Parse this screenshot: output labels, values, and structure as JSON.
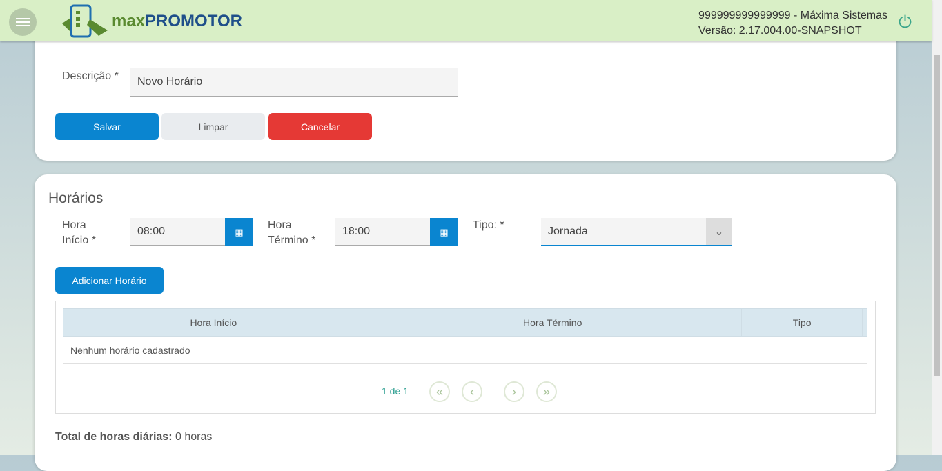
{
  "header": {
    "logo_prefix": "max",
    "logo_name": "PROMOTOR",
    "user": "999999999999999 - Máxima Sistemas",
    "version": "Versão: 2.17.004.00-SNAPSHOT"
  },
  "form": {
    "descricao_label": "Descrição *",
    "descricao_value": "Novo Horário",
    "save": "Salvar",
    "clear": "Limpar",
    "cancel": "Cancelar"
  },
  "horarios": {
    "title": "Horários",
    "inicio_label": "Hora Início *",
    "inicio_value": "08:00",
    "termino_label": "Hora Término *",
    "termino_value": "18:00",
    "tipo_label": "Tipo: *",
    "tipo_value": "Jornada",
    "add": "Adicionar Horário",
    "columns": [
      "Hora Início",
      "Hora Término",
      "Tipo",
      ""
    ],
    "empty": "Nenhum horário cadastrado",
    "page": "1 de 1",
    "total_label": "Total de horas diárias:",
    "total_value": " 0 horas"
  },
  "colors": {
    "primary": "#0a85d0",
    "danger": "#e53935",
    "header": "#d9efc6"
  }
}
